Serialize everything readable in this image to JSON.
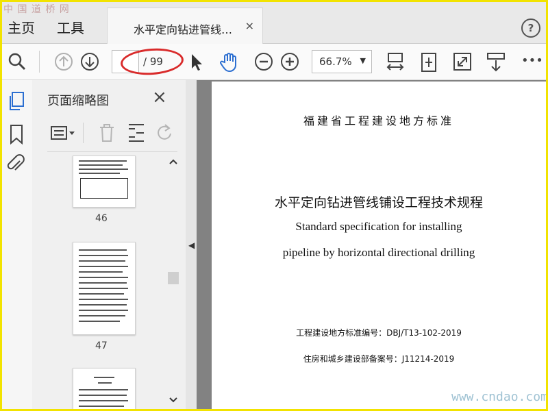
{
  "watermarks": {
    "top_left": "中 国 道 桥 网",
    "bottom_right": "www.cndao.com"
  },
  "menu": {
    "home": "主页",
    "tools": "工具"
  },
  "tab": {
    "title": "水平定向钻进管线…",
    "close": "×"
  },
  "help": {
    "label": "?"
  },
  "toolbar": {
    "page_current": "",
    "page_total": "/ 99",
    "zoom": "66.7%",
    "zoom_arrow": "▼",
    "more": "•••"
  },
  "panel": {
    "title": "页面缩略图",
    "close": "×",
    "thumbnails": [
      {
        "label": "46"
      },
      {
        "label": "47"
      }
    ]
  },
  "collapse": {
    "arrow": "◀"
  },
  "document": {
    "header": "福建省工程建设地方标准",
    "title_cn": "水平定向钻进管线铺设工程技术规程",
    "title_en_line1": "Standard specification for installing",
    "title_en_line2": "pipeline by horizontal directional drilling",
    "std_no": "工程建设地方标准编号：DBJ/T13-102-2019",
    "filing_no": "住房和城乡建设部备案号：J11214-2019"
  },
  "colors": {
    "frame": "#f2e300",
    "annotation": "#d92b2b",
    "hand_tool": "#2c6fd1",
    "doc_bg": "#828282"
  }
}
